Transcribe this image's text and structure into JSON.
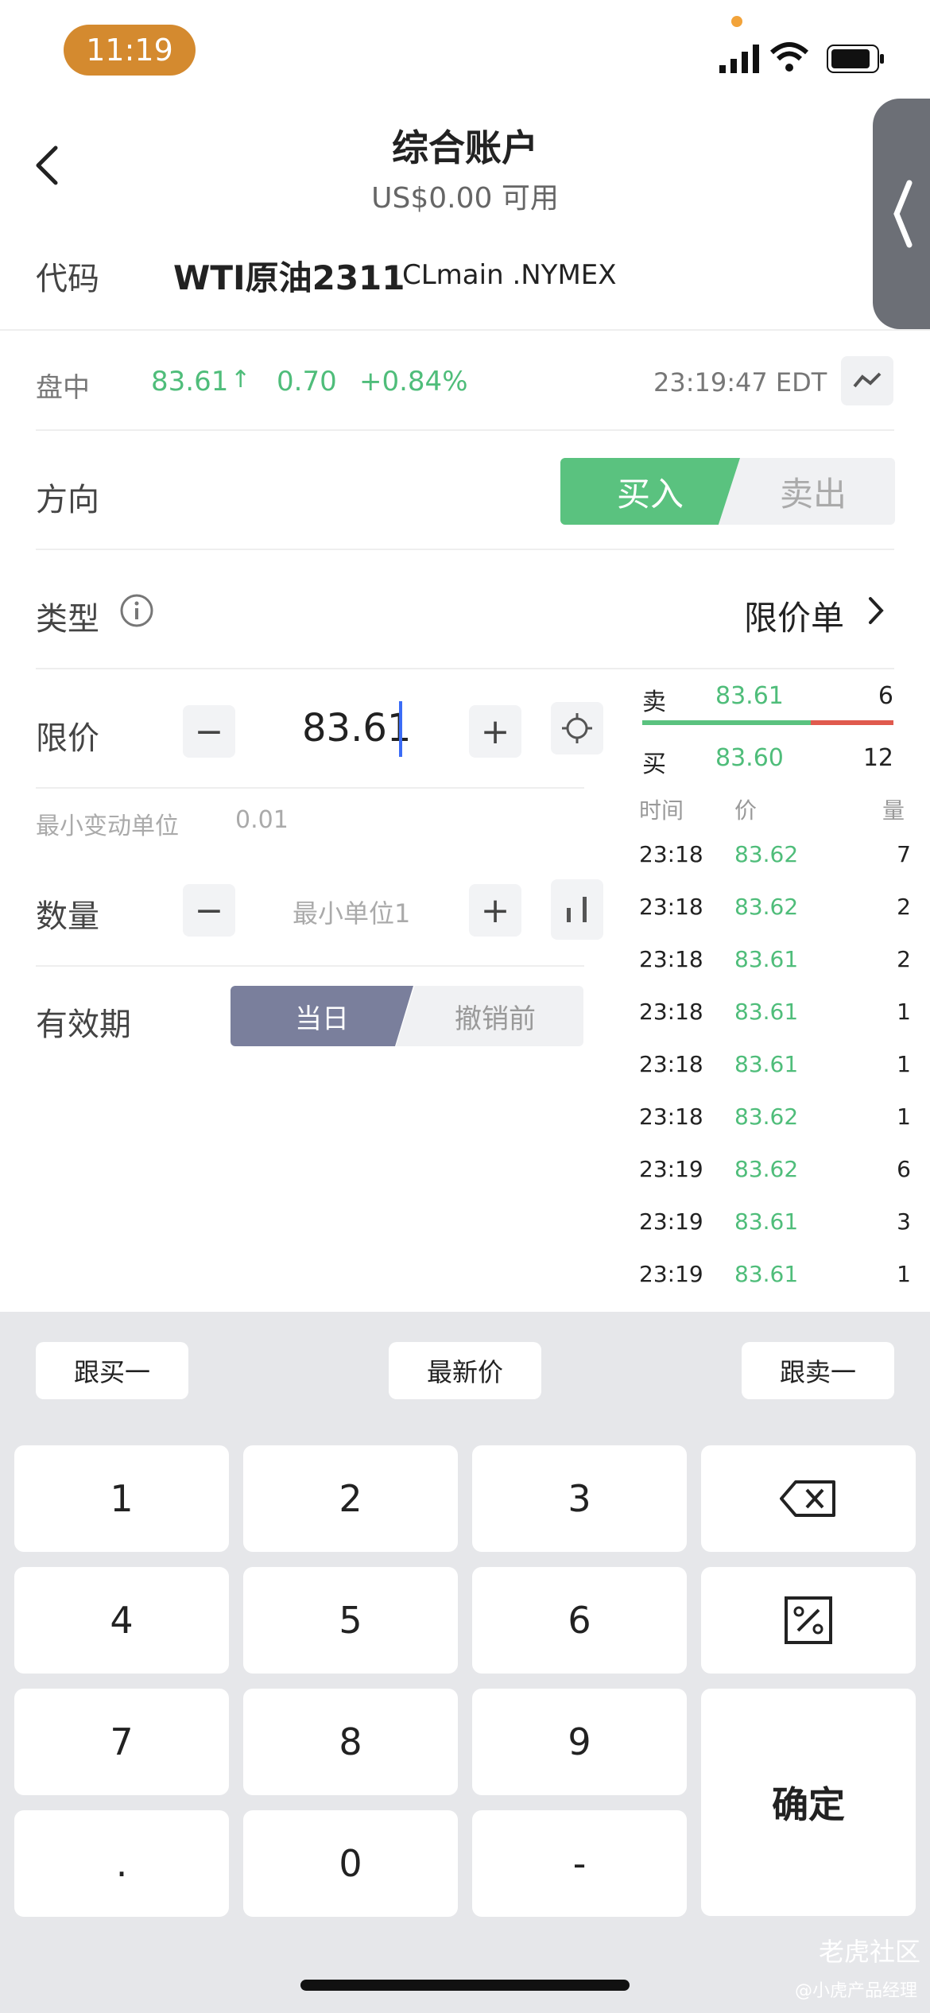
{
  "status_bar": {
    "time": "11:19"
  },
  "header": {
    "title": "综合账户",
    "subtitle": "US$0.00 可用"
  },
  "symbol": {
    "label": "代码",
    "name": "WTI原油2311",
    "code": "CLmain .NYMEX"
  },
  "quote": {
    "session": "盘中",
    "price": "83.61",
    "arrow": "↑",
    "change": "0.70",
    "change_pct": "+0.84%",
    "time": "23:19:47 EDT"
  },
  "direction": {
    "label": "方向",
    "buy": "买入",
    "sell": "卖出"
  },
  "order_type": {
    "label": "类型",
    "value": "限价单"
  },
  "limit": {
    "label": "限价",
    "value": "83.61",
    "min_tick_label": "最小变动单位",
    "min_tick": "0.01"
  },
  "quantity": {
    "label": "数量",
    "placeholder": "最小单位1"
  },
  "validity": {
    "label": "有效期",
    "today": "当日",
    "gtc": "撤销前"
  },
  "order_book": {
    "ask": {
      "side": "卖",
      "price": "83.61",
      "size": "6"
    },
    "bid": {
      "side": "买",
      "price": "83.60",
      "size": "12"
    },
    "bid_ratio": 0.67,
    "headers": {
      "time": "时间",
      "price": "价",
      "size": "量"
    },
    "ticks": [
      {
        "time": "23:18",
        "price": "83.62",
        "size": "7"
      },
      {
        "time": "23:18",
        "price": "83.62",
        "size": "2"
      },
      {
        "time": "23:18",
        "price": "83.61",
        "size": "2"
      },
      {
        "time": "23:18",
        "price": "83.61",
        "size": "1"
      },
      {
        "time": "23:18",
        "price": "83.61",
        "size": "1"
      },
      {
        "time": "23:18",
        "price": "83.62",
        "size": "1"
      },
      {
        "time": "23:19",
        "price": "83.62",
        "size": "6"
      },
      {
        "time": "23:19",
        "price": "83.61",
        "size": "3"
      },
      {
        "time": "23:19",
        "price": "83.61",
        "size": "1"
      }
    ]
  },
  "keyboard": {
    "quick": {
      "follow_buy": "跟买一",
      "latest": "最新价",
      "follow_sell": "跟卖一"
    },
    "keys": [
      "1",
      "2",
      "3",
      "4",
      "5",
      "6",
      "7",
      "8",
      "9",
      ".",
      "0",
      "-"
    ],
    "confirm": "确定"
  },
  "watermark": {
    "brand": "老虎社区",
    "author": "@小虎产品经理"
  },
  "colors": {
    "buy_green": "#5ac27f",
    "sell_red": "#e05a4e",
    "accent_orange": "#d48a2f",
    "validity_blue": "#7a7f9c"
  }
}
